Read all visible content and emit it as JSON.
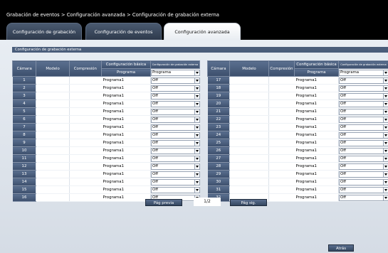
{
  "breadcrumb": "Grabación de eventos > Configuración avanzada > Configuración de grabación externa",
  "tabs": [
    {
      "label": "Configuración de grabación"
    },
    {
      "label": "Configuración de eventos"
    },
    {
      "label": "Configuración avanzada"
    }
  ],
  "section_title": "Configuración de grabación externa",
  "table": {
    "headers": {
      "camera": "Cámara",
      "model": "Modelo",
      "compression": "Compresión",
      "basic": "Configuración básica",
      "external": "Configuración de grabación externa",
      "program": "Programa"
    },
    "header_select_value": "Programa",
    "left_rows": [
      {
        "camera": "1",
        "program": "Programa1",
        "value": "Off"
      },
      {
        "camera": "2",
        "program": "Programa1",
        "value": "Off"
      },
      {
        "camera": "3",
        "program": "Programa1",
        "value": "Off"
      },
      {
        "camera": "4",
        "program": "Programa1",
        "value": "Off"
      },
      {
        "camera": "5",
        "program": "Programa1",
        "value": "Off"
      },
      {
        "camera": "6",
        "program": "Programa1",
        "value": "Off"
      },
      {
        "camera": "7",
        "program": "Programa1",
        "value": "Off"
      },
      {
        "camera": "8",
        "program": "Programa1",
        "value": "Off"
      },
      {
        "camera": "9",
        "program": "Programa1",
        "value": "Off"
      },
      {
        "camera": "10",
        "program": "Programa1",
        "value": "Off"
      },
      {
        "camera": "11",
        "program": "Programa1",
        "value": "Off"
      },
      {
        "camera": "12",
        "program": "Programa1",
        "value": "Off"
      },
      {
        "camera": "13",
        "program": "Programa1",
        "value": "Off"
      },
      {
        "camera": "14",
        "program": "Programa1",
        "value": "Off"
      },
      {
        "camera": "15",
        "program": "Programa1",
        "value": "Off"
      },
      {
        "camera": "16",
        "program": "Programa1",
        "value": "Off"
      }
    ],
    "right_rows": [
      {
        "camera": "17",
        "program": "Programa1",
        "value": "Off"
      },
      {
        "camera": "18",
        "program": "Programa1",
        "value": "Off"
      },
      {
        "camera": "19",
        "program": "Programa1",
        "value": "Off"
      },
      {
        "camera": "20",
        "program": "Programa1",
        "value": "Off"
      },
      {
        "camera": "21",
        "program": "Programa1",
        "value": "Off"
      },
      {
        "camera": "22",
        "program": "Programa1",
        "value": "Off"
      },
      {
        "camera": "23",
        "program": "Programa1",
        "value": "Off"
      },
      {
        "camera": "24",
        "program": "Programa1",
        "value": "Off"
      },
      {
        "camera": "25",
        "program": "Programa1",
        "value": "Off"
      },
      {
        "camera": "26",
        "program": "Programa1",
        "value": "Off"
      },
      {
        "camera": "27",
        "program": "Programa1",
        "value": "Off"
      },
      {
        "camera": "28",
        "program": "Programa1",
        "value": "Off"
      },
      {
        "camera": "29",
        "program": "Programa1",
        "value": "Off"
      },
      {
        "camera": "30",
        "program": "Programa1",
        "value": "Off"
      },
      {
        "camera": "31",
        "program": "Programa1",
        "value": "Off"
      },
      {
        "camera": "32",
        "program": "Programa1",
        "value": "Off"
      }
    ]
  },
  "pagination": {
    "prev_label": "Pág previa",
    "indicator": "1/2",
    "next_label": "Pág sig."
  },
  "back_label": "Atrás",
  "icons": {
    "dropdown": "chevron-down-icon"
  }
}
